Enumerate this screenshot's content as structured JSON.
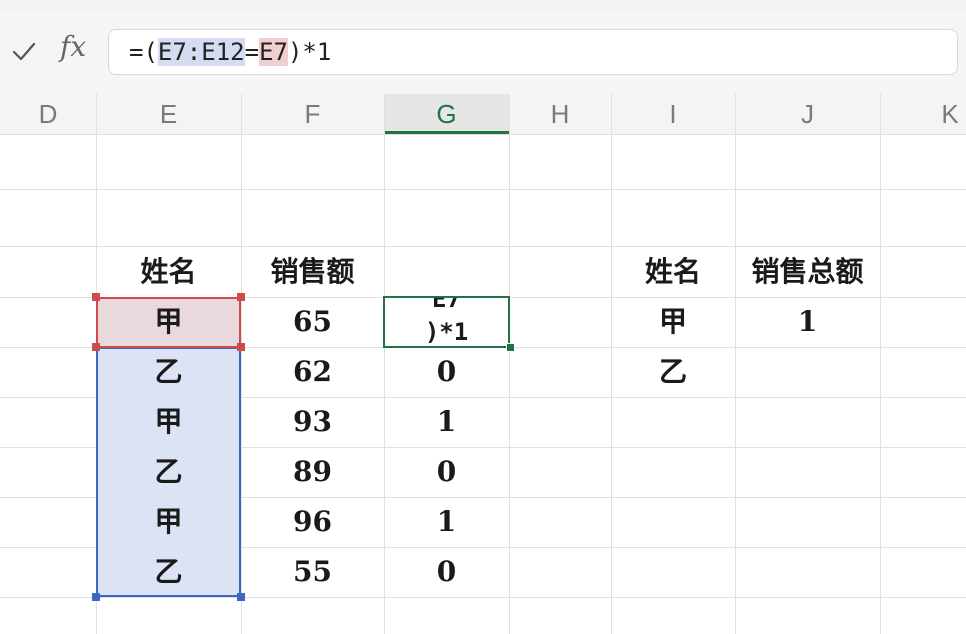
{
  "formula_bar": {
    "fx_label": "fx",
    "formula_prefix": "=(",
    "ref_range": "E7:E12",
    "operator": "=",
    "ref_cell": "E7",
    "formula_suffix": ")*1"
  },
  "columns": [
    "D",
    "E",
    "F",
    "G",
    "H",
    "I",
    "J",
    "K"
  ],
  "table1": {
    "headers": [
      "姓名",
      "销售额"
    ],
    "rows": [
      {
        "name": "甲",
        "sales": "65"
      },
      {
        "name": "乙",
        "sales": "62"
      },
      {
        "name": "甲",
        "sales": "93"
      },
      {
        "name": "乙",
        "sales": "89"
      },
      {
        "name": "甲",
        "sales": "96"
      },
      {
        "name": "乙",
        "sales": "55"
      }
    ]
  },
  "g_column": {
    "active_cell_line1": "E7",
    "active_cell_line2": ")*1",
    "values": [
      "0",
      "1",
      "0",
      "1",
      "0"
    ]
  },
  "table2": {
    "headers": [
      "姓名",
      "销售总额"
    ],
    "rows": [
      {
        "name": "甲",
        "total": "1"
      },
      {
        "name": "乙",
        "total": ""
      }
    ]
  },
  "colors": {
    "accent_green": "#217346",
    "ref_blue": "#3a67c2",
    "ref_red": "#cf4a4a",
    "selection_fill": "#dbe3f5"
  },
  "icons": [
    "check-icon"
  ]
}
